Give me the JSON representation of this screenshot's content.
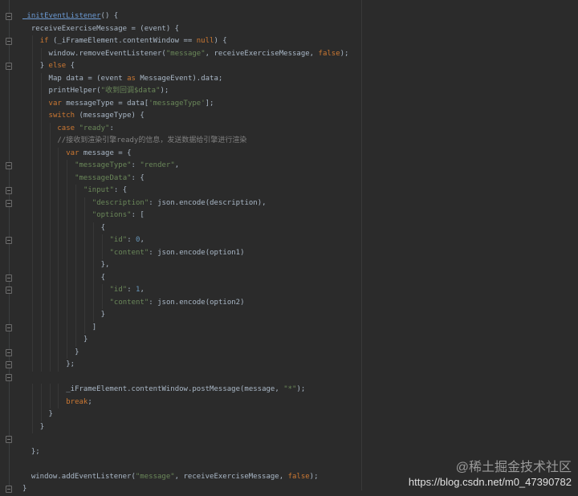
{
  "editor": {
    "colors": {
      "background": "#2b2b2b",
      "keyword": "#cc7832",
      "string": "#6a8759",
      "number": "#6897bb",
      "text": "#a9b7c6",
      "comment": "#808080"
    },
    "fold_lines": [
      0,
      2,
      4,
      12,
      14,
      15,
      18,
      21,
      22,
      25,
      27,
      28,
      29,
      34,
      38
    ],
    "lines": [
      {
        "indent": 0,
        "tokens": [
          [
            "_initEventListener",
            "fn"
          ],
          [
            "() {",
            "plain"
          ]
        ]
      },
      {
        "indent": 1,
        "tokens": [
          [
            "receiveExerciseMessage = (event) {",
            "plain"
          ]
        ]
      },
      {
        "indent": 2,
        "tokens": [
          [
            "if",
            "kw"
          ],
          [
            " (_iFrameElement.contentWindow == ",
            "plain"
          ],
          [
            "null",
            "kw"
          ],
          [
            ") {",
            "plain"
          ]
        ]
      },
      {
        "indent": 3,
        "tokens": [
          [
            "window.removeEventListener(",
            "plain"
          ],
          [
            "\"message\"",
            "str"
          ],
          [
            ", receiveExerciseMessage, ",
            "plain"
          ],
          [
            "false",
            "kw"
          ],
          [
            ");",
            "plain"
          ]
        ]
      },
      {
        "indent": 2,
        "tokens": [
          [
            "} ",
            "plain"
          ],
          [
            "else",
            "kw"
          ],
          [
            " {",
            "plain"
          ]
        ]
      },
      {
        "indent": 3,
        "tokens": [
          [
            "Map data = (event ",
            "plain"
          ],
          [
            "as",
            "kw"
          ],
          [
            " MessageEvent).data;",
            "plain"
          ]
        ]
      },
      {
        "indent": 3,
        "tokens": [
          [
            "printHelper(",
            "plain"
          ],
          [
            "\"收到回调$data\"",
            "str"
          ],
          [
            ");",
            "plain"
          ]
        ]
      },
      {
        "indent": 3,
        "tokens": [
          [
            "var",
            "kw"
          ],
          [
            " messageType = data[",
            "plain"
          ],
          [
            "'messageType'",
            "str"
          ],
          [
            "];",
            "plain"
          ]
        ]
      },
      {
        "indent": 3,
        "tokens": [
          [
            "switch",
            "kw"
          ],
          [
            " (messageType) {",
            "plain"
          ]
        ]
      },
      {
        "indent": 4,
        "tokens": [
          [
            "case",
            "kw"
          ],
          [
            " ",
            "plain"
          ],
          [
            "\"ready\"",
            "str"
          ],
          [
            ":",
            "plain"
          ]
        ]
      },
      {
        "indent": 4,
        "tokens": [
          [
            "//接收到渲染引擎ready的信息，发送数据给引擎进行渲染",
            "cm"
          ]
        ]
      },
      {
        "indent": 5,
        "tokens": [
          [
            "var",
            "kw"
          ],
          [
            " message = {",
            "plain"
          ]
        ]
      },
      {
        "indent": 6,
        "tokens": [
          [
            "\"messageType\"",
            "str"
          ],
          [
            ": ",
            "plain"
          ],
          [
            "\"render\"",
            "str"
          ],
          [
            ",",
            "plain"
          ]
        ]
      },
      {
        "indent": 6,
        "tokens": [
          [
            "\"messageData\"",
            "str"
          ],
          [
            ": {",
            "plain"
          ]
        ]
      },
      {
        "indent": 7,
        "tokens": [
          [
            "\"input\"",
            "str"
          ],
          [
            ": {",
            "plain"
          ]
        ]
      },
      {
        "indent": 8,
        "tokens": [
          [
            "\"description\"",
            "str"
          ],
          [
            ": json.encode(description),",
            "plain"
          ]
        ]
      },
      {
        "indent": 8,
        "tokens": [
          [
            "\"options\"",
            "str"
          ],
          [
            ": [",
            "plain"
          ]
        ]
      },
      {
        "indent": 9,
        "tokens": [
          [
            "{",
            "plain"
          ]
        ]
      },
      {
        "indent": 10,
        "tokens": [
          [
            "\"id\"",
            "str"
          ],
          [
            ": ",
            "plain"
          ],
          [
            "0",
            "num"
          ],
          [
            ",",
            "plain"
          ]
        ]
      },
      {
        "indent": 10,
        "tokens": [
          [
            "\"content\"",
            "str"
          ],
          [
            ": json.encode(option1)",
            "plain"
          ]
        ]
      },
      {
        "indent": 9,
        "tokens": [
          [
            "},",
            "plain"
          ]
        ]
      },
      {
        "indent": 9,
        "tokens": [
          [
            "{",
            "plain"
          ]
        ]
      },
      {
        "indent": 10,
        "tokens": [
          [
            "\"id\"",
            "str"
          ],
          [
            ": ",
            "plain"
          ],
          [
            "1",
            "num"
          ],
          [
            ",",
            "plain"
          ]
        ]
      },
      {
        "indent": 10,
        "tokens": [
          [
            "\"content\"",
            "str"
          ],
          [
            ": json.encode(option2)",
            "plain"
          ]
        ]
      },
      {
        "indent": 9,
        "tokens": [
          [
            "}",
            "plain"
          ]
        ]
      },
      {
        "indent": 8,
        "tokens": [
          [
            "]",
            "plain"
          ]
        ]
      },
      {
        "indent": 7,
        "tokens": [
          [
            "}",
            "plain"
          ]
        ]
      },
      {
        "indent": 6,
        "tokens": [
          [
            "}",
            "plain"
          ]
        ]
      },
      {
        "indent": 5,
        "tokens": [
          [
            "};",
            "plain"
          ]
        ]
      },
      {
        "indent": 0,
        "tokens": []
      },
      {
        "indent": 5,
        "tokens": [
          [
            "_iFrameElement.contentWindow.postMessage(message, ",
            "plain"
          ],
          [
            "\"*\"",
            "str"
          ],
          [
            ");",
            "plain"
          ]
        ]
      },
      {
        "indent": 5,
        "tokens": [
          [
            "break",
            "kw"
          ],
          [
            ";",
            "plain"
          ]
        ]
      },
      {
        "indent": 3,
        "tokens": [
          [
            "}",
            "plain"
          ]
        ]
      },
      {
        "indent": 2,
        "tokens": [
          [
            "}",
            "plain"
          ]
        ]
      },
      {
        "indent": 0,
        "tokens": []
      },
      {
        "indent": 1,
        "tokens": [
          [
            "};",
            "plain"
          ]
        ]
      },
      {
        "indent": 0,
        "tokens": []
      },
      {
        "indent": 1,
        "tokens": [
          [
            "window.addEventListener(",
            "plain"
          ],
          [
            "\"message\"",
            "str"
          ],
          [
            ", receiveExerciseMessage, ",
            "plain"
          ],
          [
            "false",
            "kw"
          ],
          [
            ");",
            "plain"
          ]
        ]
      },
      {
        "indent": 0,
        "tokens": [
          [
            "}",
            "plain"
          ]
        ]
      }
    ]
  },
  "watermark": {
    "line1": "@稀土掘金技术社区",
    "line2": "https://blog.csdn.net/m0_47390782"
  }
}
